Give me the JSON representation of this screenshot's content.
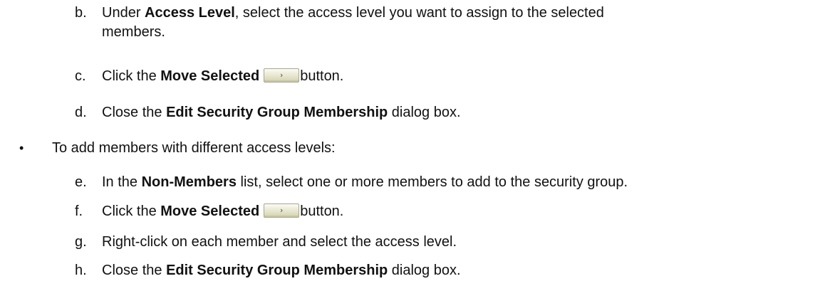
{
  "steps_b_to_d": [
    {
      "marker": "b.",
      "pre": "Under ",
      "bold": "Access Level",
      "post": ", select the access level you want to assign to the selected members."
    },
    {
      "marker": "c.",
      "pre": "Click the ",
      "bold": "Move Selected",
      "post": "button.",
      "button_icon": "chevron-right-icon"
    },
    {
      "marker": "d.",
      "pre": "Close the ",
      "bold": "Edit Security Group Membership",
      "post": " dialog box."
    }
  ],
  "bullet": {
    "symbol": "•",
    "text": "To add members with different access levels:"
  },
  "steps_e_to_h": [
    {
      "marker": "e.",
      "pre": "In the ",
      "bold": "Non-Members",
      "post": " list, select one or more members to add to the security group."
    },
    {
      "marker": "f.",
      "pre": "Click the ",
      "bold": "Move Selected",
      "post": "button.",
      "button_icon": "chevron-right-icon"
    },
    {
      "marker": "g.",
      "text": "Right-click on each member and select the access level."
    },
    {
      "marker": "h.",
      "pre": "Close the ",
      "bold": "Edit Security Group Membership",
      "post": " dialog box."
    }
  ],
  "button_glyph": "›",
  "colors": {
    "text": "#111111",
    "button_face": "#e4e3c9",
    "button_border": "#a6a796"
  }
}
